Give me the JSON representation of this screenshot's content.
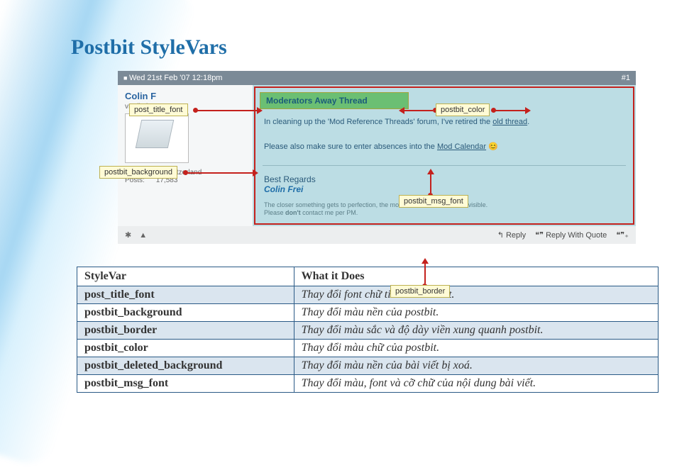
{
  "page_title": "Postbit StyleVars",
  "post": {
    "date": "Wed 21st Feb '07 12:18pm",
    "number": "#1",
    "username": "Colin F",
    "usertitle": "vBulletin",
    "location_label": "Location:",
    "location": "Switzerland",
    "posts_label": "Posts:",
    "posts": "17,583",
    "thread_title": "Moderators Away Thread",
    "msg_line1": "In cleaning up the 'Mod Reference Threads' forum, I've retired the ",
    "msg_link1": "old thread",
    "msg_line1b": ".",
    "msg_line2": "Please also make sure to enter absences into the ",
    "msg_link2": "Mod Calendar",
    "regards": "Best Regards",
    "sig_name": "Colin Frei",
    "fine1": "The closer something gets to perfection, the more minute flaws become visible.",
    "fine2_a": "Please ",
    "fine2_b": "don't",
    "fine2_c": " contact me per PM.",
    "foot_reply": "Reply",
    "foot_quote": "Reply With Quote"
  },
  "callouts": {
    "post_title_font": "post_title_font",
    "postbit_color": "postbit_color",
    "postbit_background": "postbit_background",
    "postbit_msg_font": "postbit_msg_font",
    "postbit_border": "postbit_border"
  },
  "table": {
    "h1": "StyleVar",
    "h2": "What it Does",
    "rows": [
      {
        "sv": "post_title_font",
        "desc": "Thay đổi font chữ tiêu đề bài viết."
      },
      {
        "sv": "postbit_background",
        "desc": "Thay đổi màu nền của postbit."
      },
      {
        "sv": "postbit_border",
        "desc": "Thay đổi màu sắc và độ dày viền xung quanh postbit."
      },
      {
        "sv": "postbit_color",
        "desc": "Thay đổi màu chữ của postbit."
      },
      {
        "sv": "postbit_deleted_background",
        "desc": "Thay đổi màu nền của bài viết bị xoá."
      },
      {
        "sv": "postbit_msg_font",
        "desc": "Thay đổi màu, font và cỡ chữ của nội dung bài viết."
      }
    ]
  }
}
